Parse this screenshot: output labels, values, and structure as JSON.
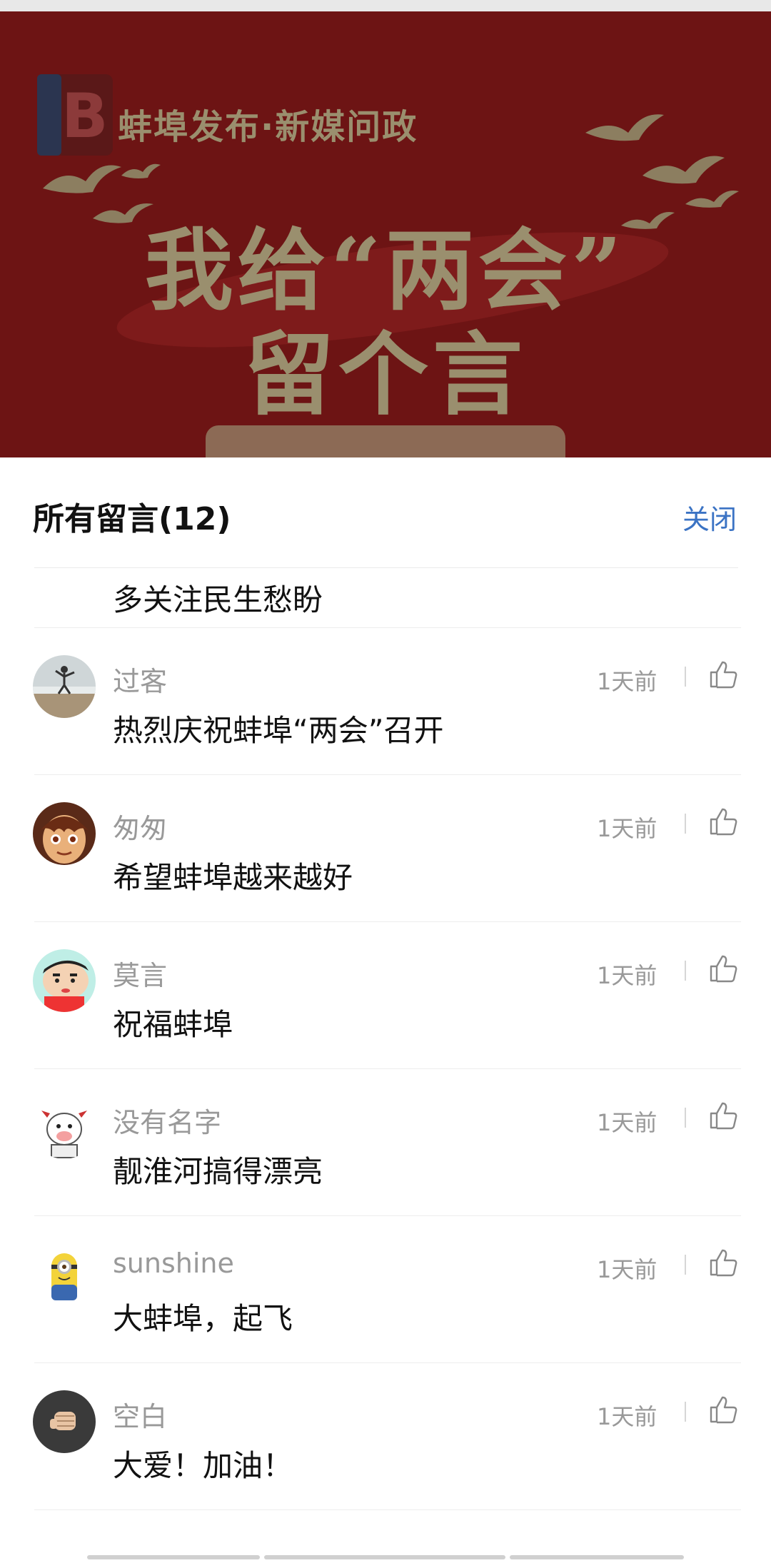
{
  "banner": {
    "brand": "蚌埠发布·新媒问政",
    "headline_line1": "我给“两会”",
    "headline_line2": "留个言",
    "logo_icon": "bengbu-release-logo-icon",
    "accent_color": "#6d1414"
  },
  "sheet": {
    "title": "所有留言(12)",
    "close_label": "关闭",
    "partial_comment_text": "多关注民生愁盼"
  },
  "comments": [
    {
      "username": "过客",
      "text": "热烈庆祝蚌埠“两会”召开",
      "time": "1天前",
      "avatar_icon": "beach-person-avatar-icon"
    },
    {
      "username": "匆匆",
      "text": "希望蚌埠越来越好",
      "time": "1天前",
      "avatar_icon": "anime-girl-avatar-icon"
    },
    {
      "username": "莫言",
      "text": "祝福蚌埠",
      "time": "1天前",
      "avatar_icon": "crayon-shin-chan-avatar-icon"
    },
    {
      "username": "没有名字",
      "text": "靓淮河搞得漂亮",
      "time": "1天前",
      "avatar_icon": "cartoon-cow-avatar-icon"
    },
    {
      "username": "sunshine",
      "text": "大蚌埠，起飞",
      "time": "1天前",
      "avatar_icon": "minion-avatar-icon"
    },
    {
      "username": "空白",
      "text": "大爱！加油！",
      "time": "1天前",
      "avatar_icon": "fist-avatar-icon"
    }
  ],
  "like_icon": "thumbs-up-icon",
  "link_color": "#3b73c4"
}
